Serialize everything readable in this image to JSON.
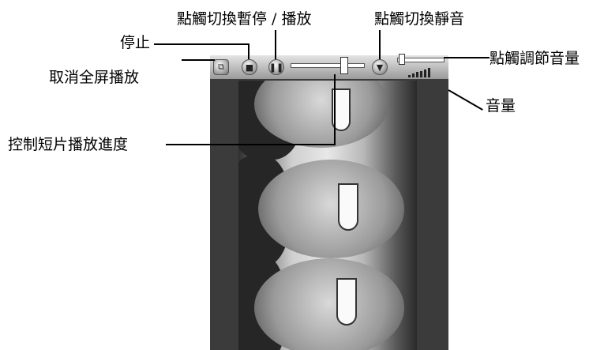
{
  "labels": {
    "stop": "停止",
    "toggle_pause_play": "點觸切換暫停 / 播放",
    "toggle_mute": "點觸切換靜音",
    "exit_fullscreen": "取消全屏播放",
    "adjust_volume": "點觸調節音量",
    "volume": "音量",
    "seek_progress": "控制短片播放進度"
  },
  "icons": [
    "exit-fullscreen-icon",
    "stop-icon",
    "pause-play-icon",
    "mute-icon",
    "volume-knob-icon"
  ],
  "progress_fraction": 0.72,
  "volume_fraction": 0.1,
  "volume_level_bars": 6
}
